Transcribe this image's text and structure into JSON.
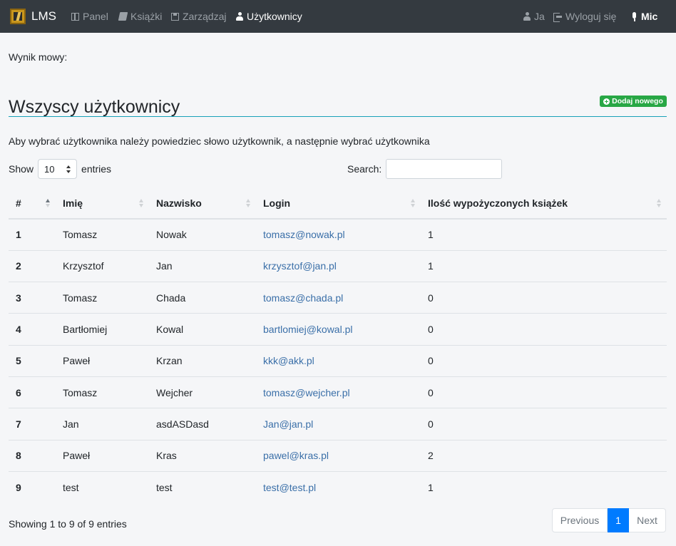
{
  "navbar": {
    "brand": "LMS",
    "items": [
      {
        "label": "Panel",
        "icon": "panel-icon"
      },
      {
        "label": "Książki",
        "icon": "book-icon"
      },
      {
        "label": "Zarządzaj",
        "icon": "save-icon"
      },
      {
        "label": "Użytkownicy",
        "icon": "user-icon",
        "active": true
      }
    ],
    "right_items": [
      {
        "label": "Ja",
        "icon": "user-icon"
      },
      {
        "label": "Wyloguj się",
        "icon": "logout-icon"
      },
      {
        "label": "Mic",
        "icon": "microphone-icon"
      }
    ]
  },
  "speech_result_label": "Wynik mowy:",
  "page_title": "Wszyscy użytkownicy",
  "add_button_label": "Dodaj nowego",
  "instruction": "Aby wybrać użytkownika należy powiedziec słowo użytkownik, a następnie wybrać użytkownika",
  "table_controls": {
    "show_label": "Show",
    "length_value": "10",
    "entries_label": "entries",
    "search_label": "Search:",
    "search_value": ""
  },
  "table": {
    "columns": [
      "#",
      "Imię",
      "Nazwisko",
      "Login",
      "Ilość wypożyczonych książek"
    ],
    "rows": [
      [
        "1",
        "Tomasz",
        "Nowak",
        "tomasz@nowak.pl",
        "1"
      ],
      [
        "2",
        "Krzysztof",
        "Jan",
        "krzysztof@jan.pl",
        "1"
      ],
      [
        "3",
        "Tomasz",
        "Chada",
        "tomasz@chada.pl",
        "0"
      ],
      [
        "4",
        "Bartłomiej",
        "Kowal",
        "bartlomiej@kowal.pl",
        "0"
      ],
      [
        "5",
        "Paweł",
        "Krzan",
        "kkk@akk.pl",
        "0"
      ],
      [
        "6",
        "Tomasz",
        "Wejcher",
        "tomasz@wejcher.pl",
        "0"
      ],
      [
        "7",
        "Jan",
        "asdASDasd",
        "Jan@jan.pl",
        "0"
      ],
      [
        "8",
        "Paweł",
        "Kras",
        "pawel@kras.pl",
        "2"
      ],
      [
        "9",
        "test",
        "test",
        "test@test.pl",
        "1"
      ]
    ]
  },
  "footer": {
    "info": "Showing 1 to 9 of 9 entries",
    "previous_label": "Previous",
    "current_page": "1",
    "next_label": "Next"
  },
  "colors": {
    "navbar": "#343a40",
    "accent_line": "#17a2b8",
    "add_button": "#28a745",
    "link": "#3a6fa8",
    "active_page": "#007bff"
  }
}
